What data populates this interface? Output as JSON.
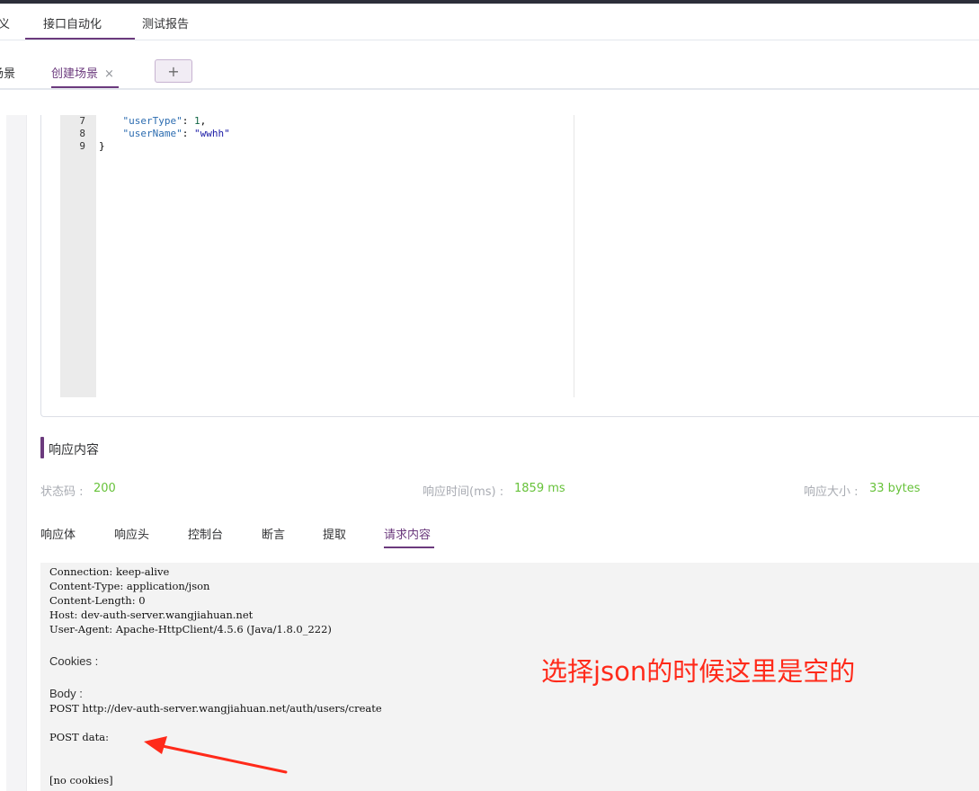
{
  "nav": {
    "items": [
      "义",
      "接口自动化",
      "测试报告"
    ]
  },
  "tabs": {
    "items": [
      "场景",
      "创建场景"
    ],
    "close_glyph": "×",
    "add_glyph": "+"
  },
  "editor": {
    "lines": [
      {
        "num": "7",
        "key": "\"userType\"",
        "sep": ": ",
        "val": "1",
        "tail": ","
      },
      {
        "num": "8",
        "key": "\"userName\"",
        "sep": ": ",
        "val": "\"wwhh\"",
        "tail": ""
      },
      {
        "num": "9",
        "text": "}"
      }
    ]
  },
  "response": {
    "title": "响应内容",
    "status_label": "状态码 :",
    "status_value": "200",
    "time_label": "响应时间(ms) :",
    "time_value": "1859 ms",
    "size_label": "响应大小 :",
    "size_value": "33 bytes",
    "tabs": [
      "响应体",
      "响应头",
      "控制台",
      "断言",
      "提取",
      "请求内容"
    ],
    "active_tab": "请求内容"
  },
  "request": {
    "headers": [
      "Connection: keep-alive",
      "Content-Type: application/json",
      "Content-Length: 0",
      "Host: dev-auth-server.wangjiahuan.net",
      "User-Agent: Apache-HttpClient/4.5.6 (Java/1.8.0_222)"
    ],
    "cookies_label": "Cookies :",
    "body_label": "Body :",
    "post_line": "POST http://dev-auth-server.wangjiahuan.net/auth/users/create",
    "post_data": "POST data:",
    "no_cookies": "[no cookies]"
  },
  "annotation": {
    "text": "选择json的时候这里是空的",
    "color": "#ff2a1a"
  },
  "colors": {
    "accent": "#6b3a7d",
    "success": "#67c23a"
  }
}
